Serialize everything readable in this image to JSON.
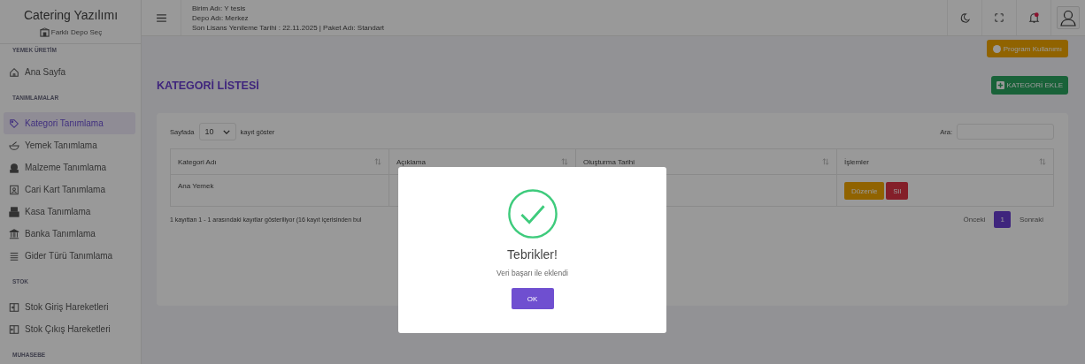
{
  "sidebar": {
    "brand": "Catering Yazılımı",
    "depot_link": "Farklı Depo Seç",
    "items": [
      {
        "kind": "section",
        "label": "YEMEK ÜRETİM"
      },
      {
        "kind": "item",
        "label": "Ana Sayfa",
        "selected": false
      },
      {
        "kind": "section",
        "label": "TANIMLAMALAR"
      },
      {
        "kind": "item",
        "label": "Kategori Tanımlama",
        "selected": true
      },
      {
        "kind": "item",
        "label": "Yemek Tanımlama",
        "selected": false
      },
      {
        "kind": "item",
        "label": "Malzeme Tanımlama",
        "selected": false
      },
      {
        "kind": "item",
        "label": "Cari Kart Tanımlama",
        "selected": false
      },
      {
        "kind": "item",
        "label": "Kasa Tanımlama",
        "selected": false
      },
      {
        "kind": "item",
        "label": "Banka Tanımlama",
        "selected": false
      },
      {
        "kind": "item",
        "label": "Gider Türü Tanımlama",
        "selected": false
      },
      {
        "kind": "section",
        "label": "STOK"
      },
      {
        "kind": "item",
        "label": "Stok Giriş Hareketleri",
        "selected": false
      },
      {
        "kind": "item",
        "label": "Stok Çıkış Hareketleri",
        "selected": false
      },
      {
        "kind": "section",
        "label": "MUHASEBE"
      }
    ]
  },
  "header": {
    "lines": [
      "Birim Adı: Y tesis",
      "Depo Adı: Merkez",
      "Son Lisans Yenileme Tarihi : 22.11.2025 | Paket Adı: Standart"
    ],
    "notification_dot": true
  },
  "help_button": "Program Kullanımı",
  "page_title": "KATEGORİ LİSTESİ",
  "add_button": "KATEGORİ EKLE",
  "table": {
    "length_prefix": "Sayfada",
    "length_value": "10",
    "length_suffix": "kayıt göster",
    "search_label": "Ara:",
    "columns": [
      "Kategori Adı",
      "Açıklama",
      "Oluşturma Tarihi",
      "İşlemler"
    ],
    "rows": [
      {
        "cells": [
          "Ana Yemek",
          "",
          ""
        ],
        "actions": [
          "Düzenle",
          "Sil"
        ]
      }
    ],
    "info": "1 kayıttan 1 - 1 arasındaki kayıtlar gösteriliyor (16 kayıt içerisinden bul",
    "pagination": [
      {
        "label": "Önceki",
        "selected": false
      },
      {
        "label": "1",
        "selected": true
      },
      {
        "label": "Sonraki",
        "selected": false
      }
    ]
  },
  "dialog": {
    "title": "Tebrikler!",
    "message": "Veri başarı ile eklendi",
    "button": "OK"
  }
}
